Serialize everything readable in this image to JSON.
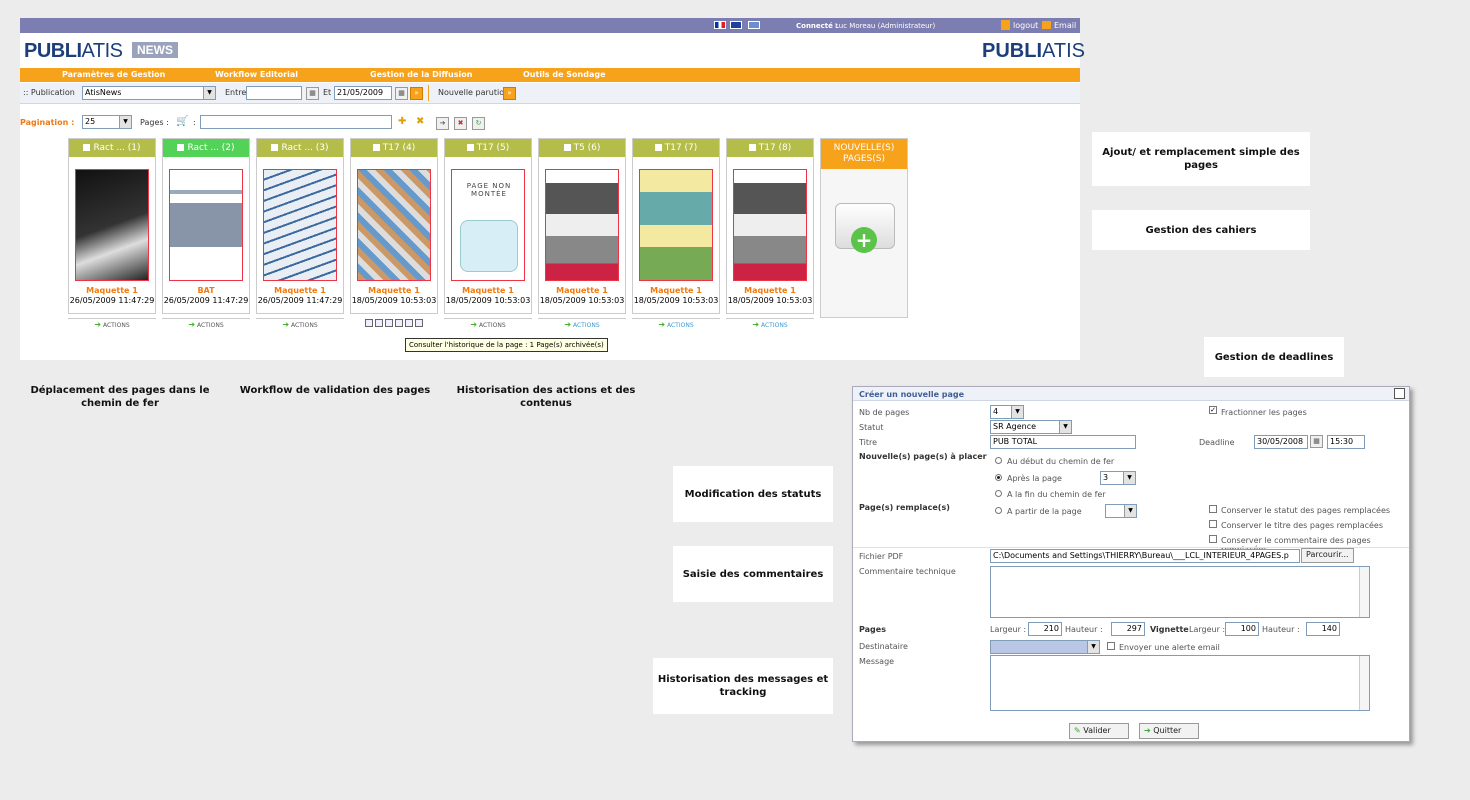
{
  "topbar": {
    "connected_label": "Connecté :",
    "connected_user": "Luc Moreau (Administrateur)",
    "logout": "logout",
    "email": "Email"
  },
  "logo": {
    "publi": "PUBLI",
    "atis": "ATIS",
    "news": "NEWS"
  },
  "menu": [
    "Paramètres de Gestion",
    "Workflow Editorial",
    "Gestion de la Diffusion",
    "Outils de Sondage"
  ],
  "toolbar": {
    "publication_label": ":: Publication",
    "publication_value": "AtisNews",
    "entre_label": "Entre",
    "et_label": "Et",
    "date_value": "21/05/2009",
    "nouvelle_parution": "Nouvelle parution"
  },
  "pagination": {
    "label": "Pagination :",
    "value": "25",
    "pages_label": "Pages :"
  },
  "cards": [
    {
      "title": "Ract ... (1)",
      "status": "Maquette 1",
      "date": "26/05/2009 11:47:29",
      "action": "ACTIONS"
    },
    {
      "title": "Ract ... (2)",
      "status": "BAT",
      "date": "26/05/2009 11:47:29",
      "action": "ACTIONS"
    },
    {
      "title": "Ract ... (3)",
      "status": "Maquette 1",
      "date": "26/05/2009 11:47:29",
      "action": "ACTIONS"
    },
    {
      "title": "T17 (4)",
      "status": "Maquette 1",
      "date": "18/05/2009 10:53:03",
      "action": ""
    },
    {
      "title": "T17 (5)",
      "status": "Maquette 1",
      "date": "18/05/2009 10:53:03",
      "action": "ACTIONS",
      "blank_text": "PAGE NON MONTÉE"
    },
    {
      "title": "T5 (6)",
      "status": "Maquette 1",
      "date": "18/05/2009 10:53:03",
      "action": "ACTIONS"
    },
    {
      "title": "T17 (7)",
      "status": "Maquette 1",
      "date": "18/05/2009 10:53:03",
      "action": "ACTIONS"
    },
    {
      "title": "T17 (8)",
      "status": "Maquette 1",
      "date": "18/05/2009 10:53:03",
      "action": "ACTIONS"
    }
  ],
  "new_card": "NOUVELLE(S) PAGES(S)",
  "tooltip": "Consulter l'historique de la page : 1 Page(s) archivée(s)",
  "features": {
    "ajout": "Ajout/ et remplacement simple des pages",
    "cahiers": "Gestion des cahiers",
    "deadlines": "Gestion de deadlines",
    "deplacement": "Déplacement des pages dans le chemin de fer",
    "workflow": "Workflow de validation des pages",
    "historisation": "Historisation des actions et des contenus",
    "statuts": "Modification des statuts",
    "commentaires": "Saisie des commentaires",
    "messages": "Historisation des messages et tracking"
  },
  "form": {
    "title": "Créer un nouvelle page",
    "nb_pages_label": "Nb de pages",
    "nb_pages": "4",
    "fractionner": "Fractionner les pages",
    "statut_label": "Statut",
    "statut": "SR Agence",
    "titre_label": "Titre",
    "titre": "PUB TOTAL",
    "deadline_label": "Deadline",
    "deadline_date": "30/05/2008",
    "deadline_time": "15:30",
    "placer_label": "Nouvelle(s) page(s) à placer",
    "opt_debut": "Au début du chemin de fer",
    "opt_apres": "Après la page",
    "apres_value": "3",
    "opt_fin": "A la fin du chemin de fer",
    "remplace_label": "Page(s) remplace(s)",
    "opt_partir": "A partir de la page",
    "conserver_statut": "Conserver le statut des pages remplacées",
    "conserver_titre": "Conserver le titre des pages remplacées",
    "conserver_comment": "Conserver le commentaire des pages remplacées",
    "pdf_label": "Fichier PDF",
    "pdf_value": "C:\\Documents and Settings\\THIERRY\\Bureau\\___LCL_INTERIEUR_4PAGES.p",
    "parcourir": "Parcourir...",
    "commentaire_label": "Commentaire technique",
    "pages_label": "Pages",
    "largeur_label": "Largeur :",
    "largeur": "210",
    "hauteur_label": "Hauteur :",
    "hauteur": "297",
    "vignette_label": "Vignette",
    "v_largeur": "100",
    "v_hauteur": "140",
    "destinataire_label": "Destinataire",
    "alerte": "Envoyer une alerte email",
    "message_label": "Message",
    "valider": "Valider",
    "quitter": "Quitter"
  }
}
